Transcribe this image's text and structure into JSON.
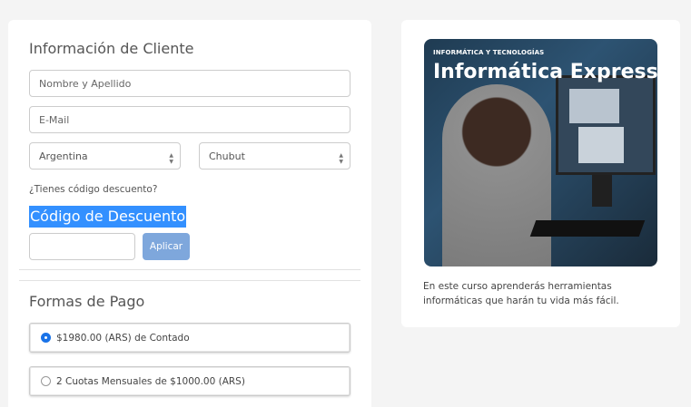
{
  "client_info": {
    "title": "Información de Cliente",
    "name_placeholder": "Nombre y Apellido",
    "email_placeholder": "E-Mail",
    "country": "Argentina",
    "province": "Chubut",
    "discount_question": "¿Tienes código descuento?",
    "discount_title": "Código de Descuento",
    "discount_value": "",
    "apply_label": "Aplicar"
  },
  "payment": {
    "title": "Formas de Pago",
    "options": [
      {
        "label": "$1980.00 (ARS) de Contado",
        "checked": true
      },
      {
        "label": "2 Cuotas Mensuales de $1000.00 (ARS)",
        "checked": false
      }
    ]
  },
  "course": {
    "tag": "INFORMÁTICA Y TECNOLOGÍAS",
    "name": "Informática Express",
    "description": "En este curso aprenderás herramientas informáticas que harán tu vida más fácil."
  }
}
